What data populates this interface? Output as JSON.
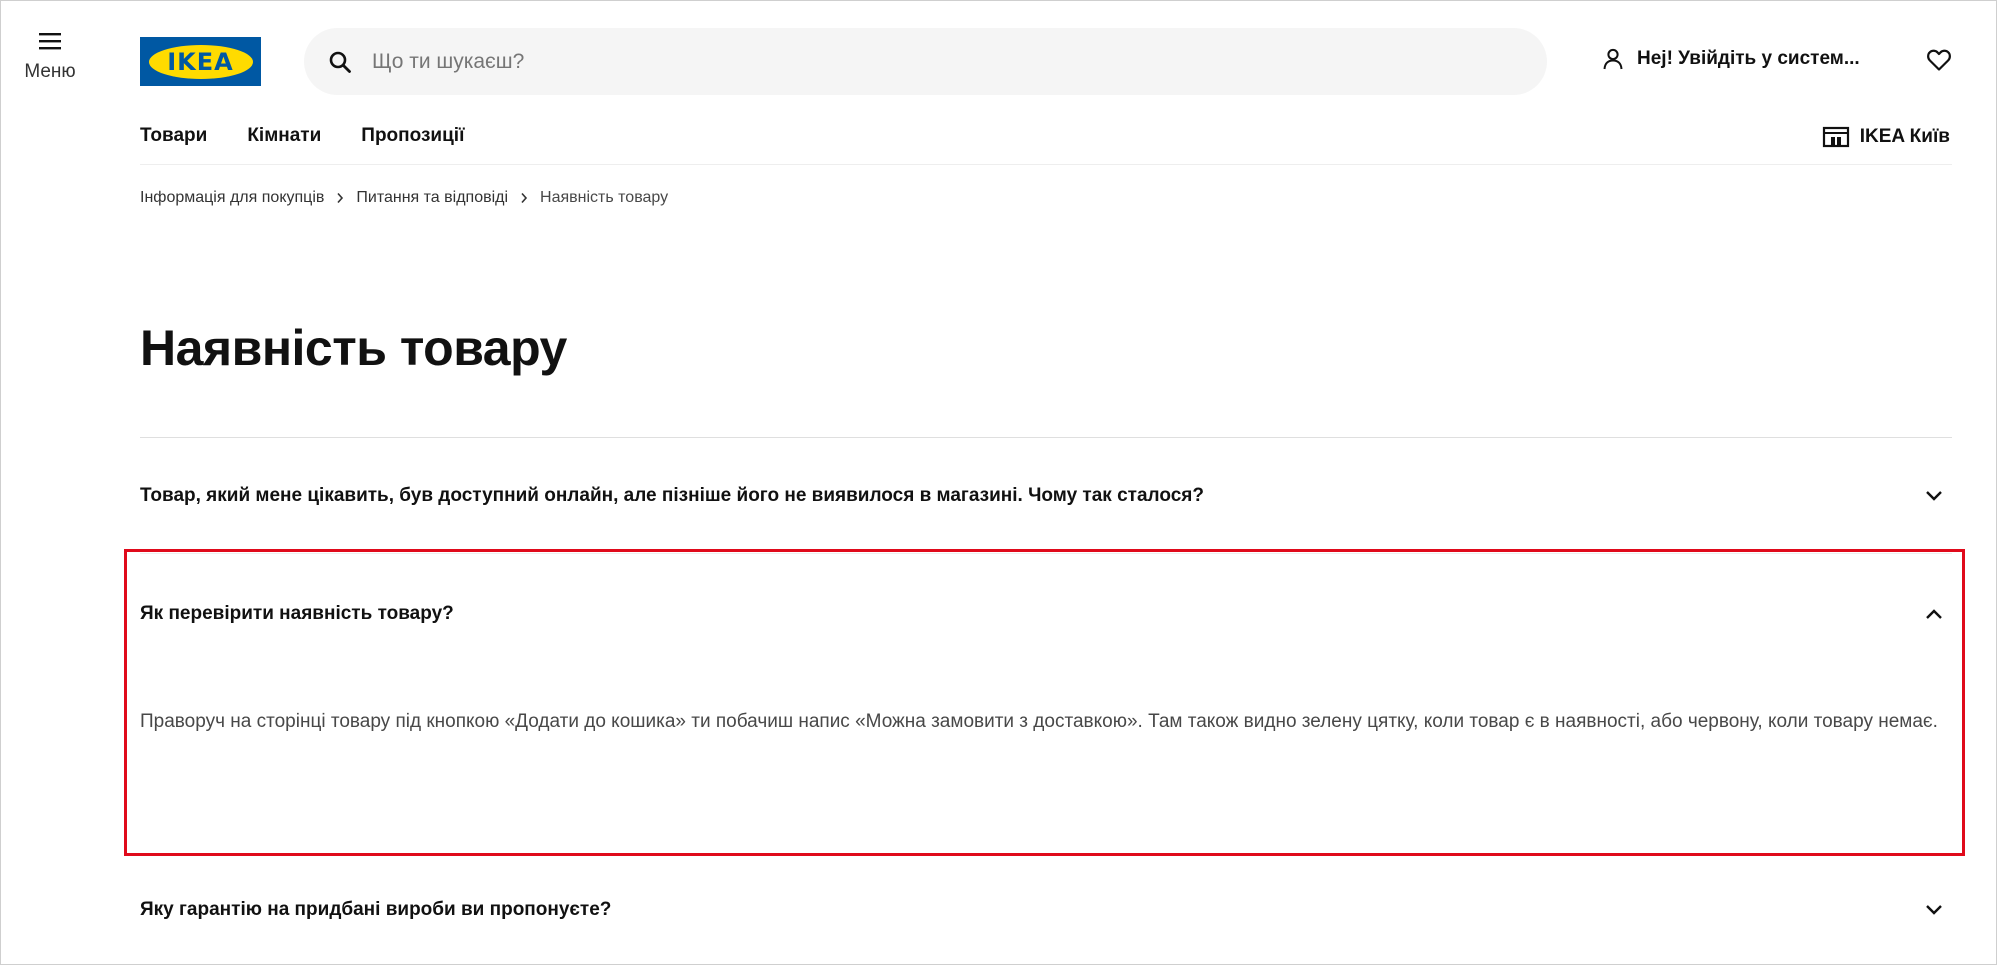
{
  "menu": {
    "label": "Меню",
    "icon": "hamburger-icon"
  },
  "logo": {
    "text": "IKEA",
    "colors": {
      "blue": "#0058a3",
      "yellow": "#ffdb00"
    }
  },
  "search": {
    "placeholder": "Що ти шукаєш?",
    "value": "",
    "icon": "search-icon"
  },
  "account": {
    "label": "Неj! Увійдіть у систем...",
    "icon": "person-icon"
  },
  "wishlist": {
    "icon": "heart-icon"
  },
  "nav": {
    "items": [
      {
        "label": "Товари"
      },
      {
        "label": "Кімнати"
      },
      {
        "label": "Пропозиції"
      }
    ],
    "store": {
      "label": "IKEA Київ",
      "icon": "store-icon"
    }
  },
  "breadcrumb": [
    {
      "label": "Інформація для покупців"
    },
    {
      "label": "Питання та відповіді"
    },
    {
      "label": "Наявність товару"
    }
  ],
  "page": {
    "title": "Наявність товару"
  },
  "faq": [
    {
      "question": "Товар, який мене цікавить, був доступний онлайн, але пізніше його не виявилося в магазині. Чому так сталося?",
      "expanded": false
    },
    {
      "question": "Як перевірити наявність товару?",
      "answer": "Праворуч на сторінці товару під кнопкою «Додати до кошика» ти побачиш напис «Можна замовити з доставкою». Там також видно зелену цятку, коли товар є в наявності, або червону, коли товару немає.",
      "expanded": true
    },
    {
      "question": "Яку гарантію на придбані вироби ви пропонуєте?",
      "expanded": false
    }
  ],
  "highlight_color": "#e00a1b"
}
